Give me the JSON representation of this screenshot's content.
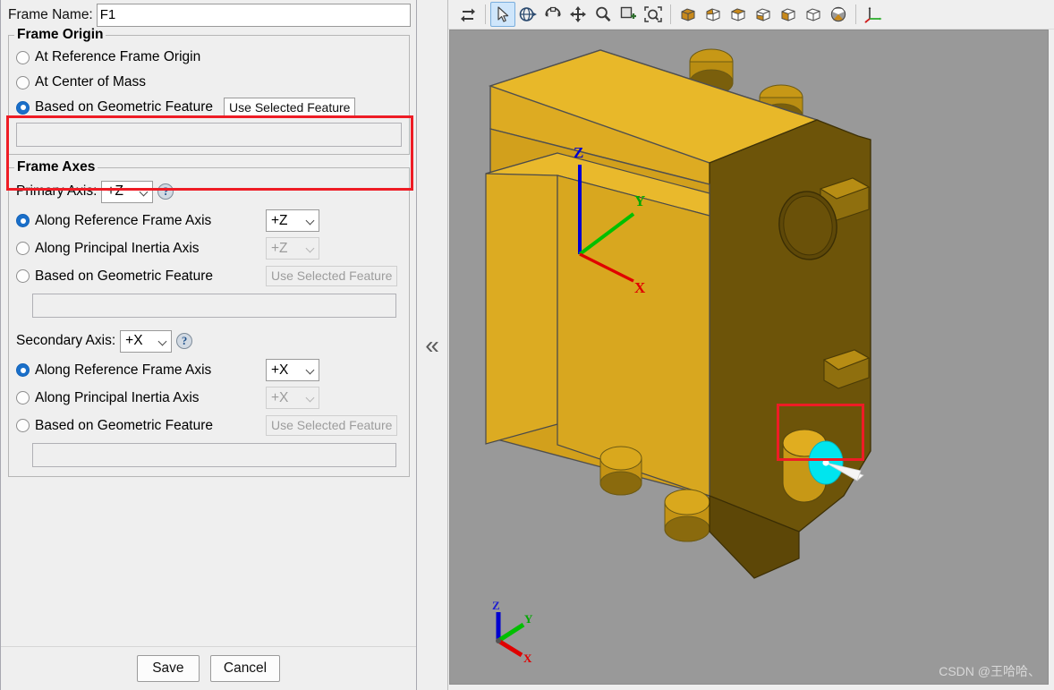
{
  "panel": {
    "frame_name_label": "Frame Name:",
    "frame_name_value": "F1",
    "origin_group": {
      "legend": "Frame Origin",
      "options": [
        {
          "label": "At Reference Frame Origin",
          "checked": false
        },
        {
          "label": "At Center of Mass",
          "checked": false
        },
        {
          "label": "Based on Geometric Feature",
          "checked": true
        }
      ],
      "feature_button": "Use Selected Feature",
      "feature_field_value": ""
    },
    "axes_group": {
      "legend": "Frame Axes",
      "primary": {
        "label": "Primary Axis:",
        "axis_value": "+Z",
        "help": "?",
        "options": [
          {
            "label": "Along Reference Frame Axis",
            "checked": true,
            "combo": "+Z",
            "disabled": false
          },
          {
            "label": "Along Principal Inertia Axis",
            "checked": false,
            "combo": "+Z",
            "disabled": true
          },
          {
            "label": "Based on Geometric Feature",
            "checked": false,
            "button": "Use Selected Feature",
            "disabled": true
          }
        ],
        "feature_field_value": ""
      },
      "secondary": {
        "label": "Secondary Axis:",
        "axis_value": "+X",
        "help": "?",
        "options": [
          {
            "label": "Along Reference Frame Axis",
            "checked": true,
            "combo": "+X",
            "disabled": false
          },
          {
            "label": "Along Principal Inertia Axis",
            "checked": false,
            "combo": "+X",
            "disabled": true
          },
          {
            "label": "Based on Geometric Feature",
            "checked": false,
            "button": "Use Selected Feature",
            "disabled": true
          }
        ],
        "feature_field_value": ""
      }
    },
    "buttons": {
      "save": "Save",
      "cancel": "Cancel"
    }
  },
  "splitter": {
    "collapse_glyph": "«"
  },
  "toolbar": {
    "items": [
      {
        "name": "swap-arrows-icon",
        "active": false
      },
      {
        "name": "select-arrow-icon",
        "active": true
      },
      {
        "name": "rotate-view-icon",
        "active": false
      },
      {
        "name": "spin-view-icon",
        "active": false
      },
      {
        "name": "pan-view-icon",
        "active": false
      },
      {
        "name": "zoom-icon",
        "active": false
      },
      {
        "name": "zoom-window-icon",
        "active": false
      },
      {
        "name": "zoom-fit-icon",
        "active": false
      },
      {
        "name": "view-iso-icon",
        "active": false
      },
      {
        "name": "view-front-icon",
        "active": false
      },
      {
        "name": "view-top-icon",
        "active": false
      },
      {
        "name": "view-bottom-icon",
        "active": false
      },
      {
        "name": "view-right-icon",
        "active": false
      },
      {
        "name": "view-left-icon",
        "active": false
      },
      {
        "name": "view-shaded-icon",
        "active": false
      },
      {
        "name": "coordinate-axes-icon",
        "active": false
      }
    ]
  },
  "viewport": {
    "background_color": "#999999",
    "model_color": "#d2a419",
    "selection_color": "#00e5ee",
    "highlight_color": "#ee1c25",
    "origin_triad": {
      "x_label": "X",
      "y_label": "Y",
      "z_label": "Z",
      "x_color": "#e00000",
      "y_color": "#00c000",
      "z_color": "#0000d0"
    },
    "corner_triad": {
      "x_label": "X",
      "y_label": "Y",
      "z_label": "Z",
      "x_color": "#e00000",
      "y_color": "#00c000",
      "z_color": "#0000d0"
    },
    "watermark": "CSDN @王哈哈、"
  }
}
